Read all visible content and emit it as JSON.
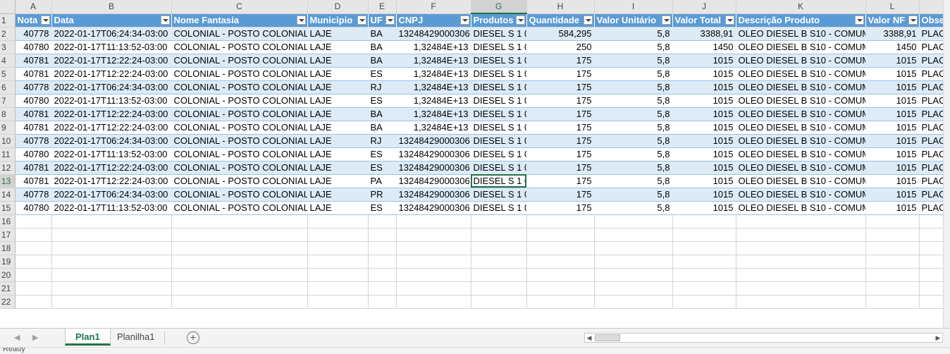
{
  "columns": [
    "A",
    "B",
    "C",
    "D",
    "E",
    "F",
    "G",
    "H",
    "I",
    "J",
    "K",
    "L",
    ""
  ],
  "headers": [
    "Nota",
    "Data",
    "Nome Fantasia",
    "Municipio",
    "UF",
    "CNPJ",
    "Produtos",
    "Quantidade",
    "Valor Unitário",
    "Valor Total",
    "Descrição Produto",
    "Valor NF",
    "Obse"
  ],
  "rows": [
    [
      "40778",
      "2022-01-17T06:24:34-03:00",
      "COLONIAL - POSTO COLONIAL",
      "LAJE",
      "BA",
      "13248429000306",
      "DIESEL S 1 0",
      "584,295",
      "5,8",
      "3388,91",
      "OLEO DIESEL B S10 - COMUM",
      "3388,91",
      "PLAC"
    ],
    [
      "40780",
      "2022-01-17T11:13:52-03:00",
      "COLONIAL - POSTO COLONIAL",
      "LAJE",
      "BA",
      "1,32484E+13",
      "DIESEL S 1 0",
      "250",
      "5,8",
      "1450",
      "OLEO DIESEL B S10 - COMUM",
      "1450",
      "PLAC"
    ],
    [
      "40781",
      "2022-01-17T12:22:24-03:00",
      "COLONIAL - POSTO COLONIAL",
      "LAJE",
      "BA",
      "1,32484E+13",
      "DIESEL S 1 0",
      "175",
      "5,8",
      "1015",
      "OLEO DIESEL B S10 - COMUM",
      "1015",
      "PLAC"
    ],
    [
      "40781",
      "2022-01-17T12:22:24-03:00",
      "COLONIAL - POSTO COLONIAL",
      "LAJE",
      "ES",
      "1,32484E+13",
      "DIESEL S 1 0",
      "175",
      "5,8",
      "1015",
      "OLEO DIESEL B S10 - COMUM",
      "1015",
      "PLAC"
    ],
    [
      "40778",
      "2022-01-17T06:24:34-03:00",
      "COLONIAL - POSTO COLONIAL",
      "LAJE",
      "RJ",
      "1,32484E+13",
      "DIESEL S 1 0",
      "175",
      "5,8",
      "1015",
      "OLEO DIESEL B S10 - COMUM",
      "1015",
      "PLAC"
    ],
    [
      "40780",
      "2022-01-17T11:13:52-03:00",
      "COLONIAL - POSTO COLONIAL",
      "LAJE",
      "ES",
      "1,32484E+13",
      "DIESEL S 1 0",
      "175",
      "5,8",
      "1015",
      "OLEO DIESEL B S10 - COMUM",
      "1015",
      "PLAC"
    ],
    [
      "40781",
      "2022-01-17T12:22:24-03:00",
      "COLONIAL - POSTO COLONIAL",
      "LAJE",
      "BA",
      "1,32484E+13",
      "DIESEL S 1 0",
      "175",
      "5,8",
      "1015",
      "OLEO DIESEL B S10 - COMUM",
      "1015",
      "PLAC"
    ],
    [
      "40781",
      "2022-01-17T12:22:24-03:00",
      "COLONIAL - POSTO COLONIAL",
      "LAJE",
      "BA",
      "1,32484E+13",
      "DIESEL S 1 0",
      "175",
      "5,8",
      "1015",
      "OLEO DIESEL B S10 - COMUM",
      "1015",
      "PLAC"
    ],
    [
      "40778",
      "2022-01-17T06:24:34-03:00",
      "COLONIAL - POSTO COLONIAL",
      "LAJE",
      "RJ",
      "13248429000306",
      "DIESEL S 1 0",
      "175",
      "5,8",
      "1015",
      "OLEO DIESEL B S10 - COMUM",
      "1015",
      "PLAC"
    ],
    [
      "40780",
      "2022-01-17T11:13:52-03:00",
      "COLONIAL - POSTO COLONIAL",
      "LAJE",
      "ES",
      "13248429000306",
      "DIESEL S 1 0",
      "175",
      "5,8",
      "1015",
      "OLEO DIESEL B S10 - COMUM",
      "1015",
      "PLAC"
    ],
    [
      "40781",
      "2022-01-17T12:22:24-03:00",
      "COLONIAL - POSTO COLONIAL",
      "LAJE",
      "ES",
      "13248429000306",
      "DIESEL S 1 0",
      "175",
      "5,8",
      "1015",
      "OLEO DIESEL B S10 - COMUM",
      "1015",
      "PLAC"
    ],
    [
      "40781",
      "2022-01-17T12:22:24-03:00",
      "COLONIAL - POSTO COLONIAL",
      "LAJE",
      "PA",
      "13248429000306",
      "DIESEL S 1 0",
      "175",
      "5,8",
      "1015",
      "OLEO DIESEL B S10 - COMUM",
      "1015",
      "PLAC"
    ],
    [
      "40778",
      "2022-01-17T06:24:34-03:00",
      "COLONIAL - POSTO COLONIAL",
      "LAJE",
      "PR",
      "13248429000306",
      "DIESEL S 1 0",
      "175",
      "5,8",
      "1015",
      "OLEO DIESEL B S10 - COMUM",
      "1015",
      "PLAC"
    ],
    [
      "40780",
      "2022-01-17T11:13:52-03:00",
      "COLONIAL - POSTO COLONIAL",
      "LAJE",
      "ES",
      "13248429000306",
      "DIESEL S 1 0",
      "175",
      "5,8",
      "1015",
      "OLEO DIESEL B S10 - COMUM",
      "1015",
      "PLAC"
    ]
  ],
  "empty_row_numbers": [
    "16",
    "17",
    "18",
    "19",
    "20",
    "21",
    "22"
  ],
  "selected_column": "G",
  "selected_row": "13",
  "sheet_tabs": [
    "Plan1",
    "Planilha1"
  ],
  "active_sheet": "Plan1",
  "add_sheet_label": "+",
  "status_text": "Ready",
  "colors": {
    "header_fill": "#5b9bd5",
    "band_fill": "#ddebf7",
    "accent": "#217346"
  }
}
